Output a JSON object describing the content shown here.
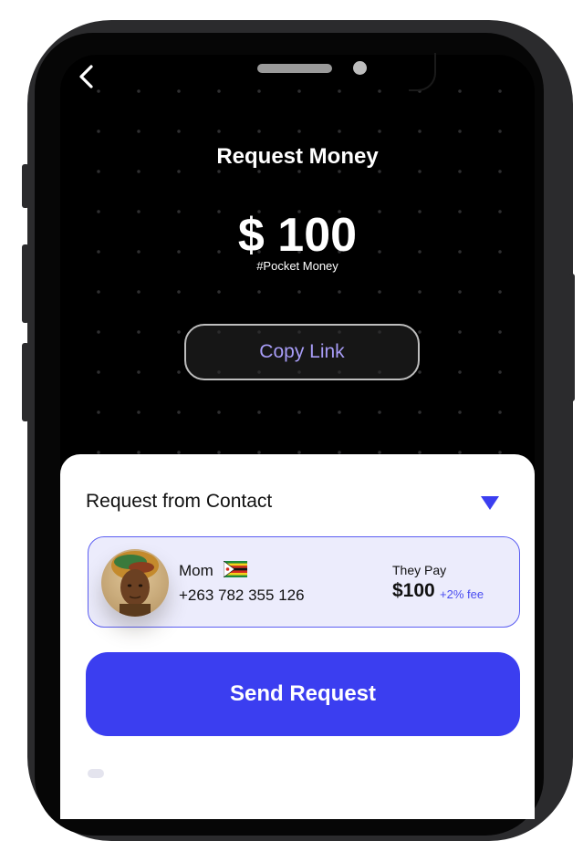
{
  "header": {
    "back_icon": "chevron-left-icon",
    "title": "Request Money"
  },
  "request": {
    "amount": "$ 100",
    "tag": "#Pocket Money",
    "copy_link_label": "Copy Link"
  },
  "contact_section": {
    "title": "Request from Contact",
    "dropdown_icon": "triangle-down-icon",
    "contact": {
      "name": "Mom",
      "flag_icon": "zimbabwe-flag-icon",
      "phone": "+263 782 355 126",
      "they_pay_label": "They Pay",
      "they_pay_amount": "$100",
      "fee": "+2% fee"
    }
  },
  "actions": {
    "send_label": "Send Request"
  },
  "colors": {
    "accent": "#3b3ef0",
    "copy_link_text": "#a79cf6",
    "card_background": "#ececfc"
  }
}
